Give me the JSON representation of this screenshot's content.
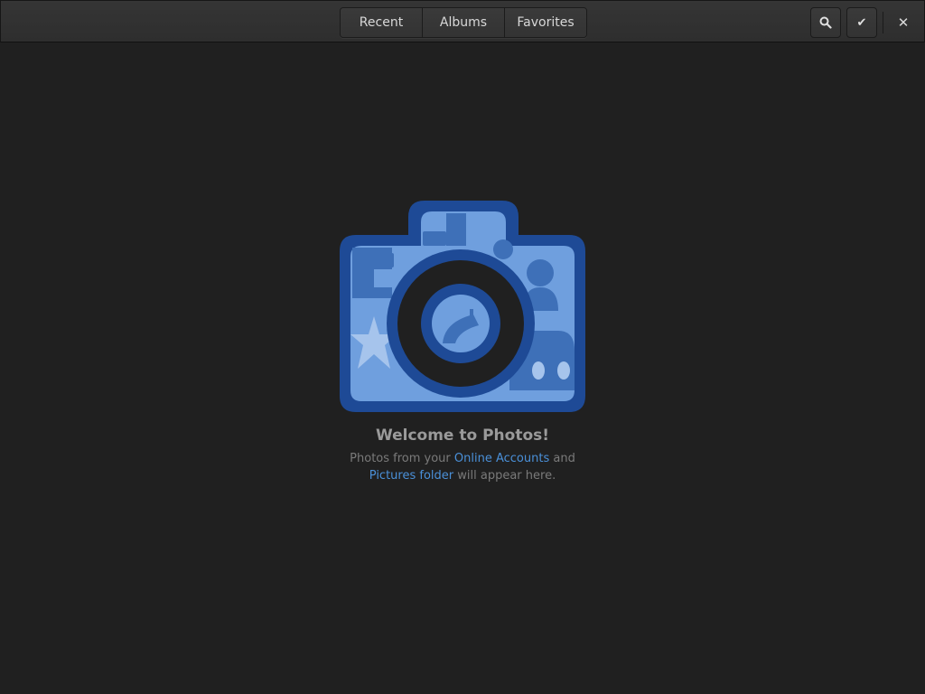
{
  "header": {
    "tabs": [
      {
        "label": "Recent"
      },
      {
        "label": "Albums"
      },
      {
        "label": "Favorites"
      }
    ],
    "search_icon": "search-icon",
    "select_icon": "checkmark-icon",
    "close_icon": "close-icon",
    "close_glyph": "✕",
    "select_glyph": "✔"
  },
  "empty_state": {
    "title": "Welcome to Photos!",
    "line1_prefix": "Photos from your ",
    "online_accounts_link": "Online Accounts",
    "line1_suffix": " and",
    "pictures_folder_link": "Pictures folder",
    "line2_suffix": " will appear here."
  },
  "colors": {
    "background": "#202020",
    "accent": "#4a90d9",
    "camera_dark": "#1e4a96",
    "camera_light": "#6f9fde"
  }
}
